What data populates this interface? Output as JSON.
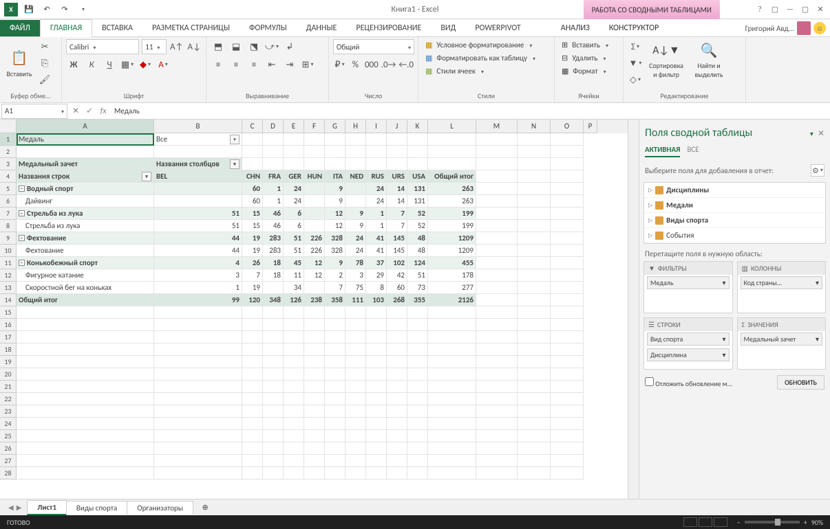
{
  "titlebar": {
    "title": "Книга1 - Excel",
    "pivot_context": "РАБОТА СО СВОДНЫМИ ТАБЛИЦАМИ"
  },
  "user": {
    "name": "Григорий Авд..."
  },
  "tabs": {
    "file": "ФАЙЛ",
    "home": "ГЛАВНАЯ",
    "insert": "ВСТАВКА",
    "layout": "РАЗМЕТКА СТРАНИЦЫ",
    "formulas": "ФОРМУЛЫ",
    "data": "ДАННЫЕ",
    "review": "РЕЦЕНЗИРОВАНИЕ",
    "view": "ВИД",
    "powerpivot": "POWERPIVOT",
    "analyze": "АНАЛИЗ",
    "design": "КОНСТРУКТОР"
  },
  "ribbon": {
    "paste": "Вставить",
    "clipboard": "Буфер обме...",
    "font_name": "Calibri",
    "font_size": "11",
    "font_group": "Шрифт",
    "align_group": "Выравнивание",
    "number_format": "Общий",
    "number_group": "Число",
    "cond_fmt": "Условное форматирование",
    "fmt_table": "Форматировать как таблицу",
    "cell_styles": "Стили ячеек",
    "styles_group": "Стили",
    "insert_btn": "Вставить",
    "delete_btn": "Удалить",
    "format_btn": "Формат",
    "cells_group": "Ячейки",
    "sort_filter": "Сортировка и фильтр",
    "find_select": "Найти и выделить",
    "editing_group": "Редактирование"
  },
  "formula_bar": {
    "name_box": "A1",
    "formula": "Медаль"
  },
  "columns": [
    "A",
    "B",
    "C",
    "D",
    "E",
    "F",
    "G",
    "H",
    "I",
    "J",
    "K",
    "L",
    "M",
    "N",
    "O",
    "P"
  ],
  "pivot": {
    "report_filter_label": "Медаль",
    "report_filter_value": "Все",
    "row_heading": "Медальный зачет",
    "col_heading": "Названия столбцов",
    "row_labels": "Названия строк",
    "cols": [
      "BEL",
      "CHN",
      "FRA",
      "GER",
      "HUN",
      "ITA",
      "NED",
      "RUS",
      "URS",
      "USA"
    ],
    "grand_col": "Общий итог",
    "grand_row": "Общий итог",
    "rows": [
      {
        "label": "Водный спорт",
        "level": 0,
        "vals": [
          "",
          "60",
          "1",
          "24",
          "",
          "9",
          "",
          "24",
          "14",
          "131"
        ],
        "total": "263",
        "bold": true,
        "exp": "-"
      },
      {
        "label": "Дайвинг",
        "level": 1,
        "vals": [
          "",
          "60",
          "1",
          "24",
          "",
          "9",
          "",
          "24",
          "14",
          "131"
        ],
        "total": "263"
      },
      {
        "label": "Стрельба из лука",
        "level": 0,
        "vals": [
          "51",
          "15",
          "46",
          "6",
          "",
          "12",
          "9",
          "1",
          "7",
          "52"
        ],
        "total": "199",
        "bold": true,
        "exp": "-"
      },
      {
        "label": "Стрельба из лука",
        "level": 1,
        "vals": [
          "51",
          "15",
          "46",
          "6",
          "",
          "12",
          "9",
          "1",
          "7",
          "52"
        ],
        "total": "199"
      },
      {
        "label": "Фехтование",
        "level": 0,
        "vals": [
          "44",
          "19",
          "283",
          "51",
          "226",
          "328",
          "24",
          "41",
          "145",
          "48"
        ],
        "total": "1209",
        "bold": true,
        "exp": "-"
      },
      {
        "label": "Фехтование",
        "level": 1,
        "vals": [
          "44",
          "19",
          "283",
          "51",
          "226",
          "328",
          "24",
          "41",
          "145",
          "48"
        ],
        "total": "1209"
      },
      {
        "label": "Конькобежный спорт",
        "level": 0,
        "vals": [
          "4",
          "26",
          "18",
          "45",
          "12",
          "9",
          "78",
          "37",
          "102",
          "124"
        ],
        "total": "455",
        "bold": true,
        "exp": "-"
      },
      {
        "label": "Фигурное катание",
        "level": 1,
        "vals": [
          "3",
          "7",
          "18",
          "11",
          "12",
          "2",
          "3",
          "29",
          "42",
          "51"
        ],
        "total": "178"
      },
      {
        "label": "Скоростной бег на коньках",
        "level": 1,
        "vals": [
          "1",
          "19",
          "",
          "34",
          "",
          "7",
          "75",
          "8",
          "60",
          "73"
        ],
        "total": "277"
      }
    ],
    "grand_vals": [
      "99",
      "120",
      "348",
      "126",
      "238",
      "358",
      "111",
      "103",
      "268",
      "355"
    ],
    "grand_total": "2126"
  },
  "taskpane": {
    "title": "Поля сводной таблицы",
    "tab_active": "АКТИВНАЯ",
    "tab_all": "ВСЕ",
    "help": "Выберите поля для добавления в отчет:",
    "fields": [
      "Дисциплины",
      "Медали",
      "Виды спорта",
      "События"
    ],
    "drag_label": "Перетащите поля в нужную область:",
    "zone_filters": "ФИЛЬТРЫ",
    "zone_columns": "КОЛОННЫ",
    "zone_rows": "СТРОКИ",
    "zone_values": "ЗНАЧЕНИЯ",
    "filter_item": "Медаль",
    "col_item": "Код страны...",
    "row_item1": "Вид спорта",
    "row_item2": "Дисциплина",
    "val_item": "Медальный зачет",
    "defer": "Отложить обновление м...",
    "update": "ОБНОВИТЬ"
  },
  "sheets": {
    "s1": "Лист1",
    "s2": "Виды спорта",
    "s3": "Организаторы"
  },
  "statusbar": {
    "ready": "ГОТОВО",
    "zoom": "90%"
  }
}
